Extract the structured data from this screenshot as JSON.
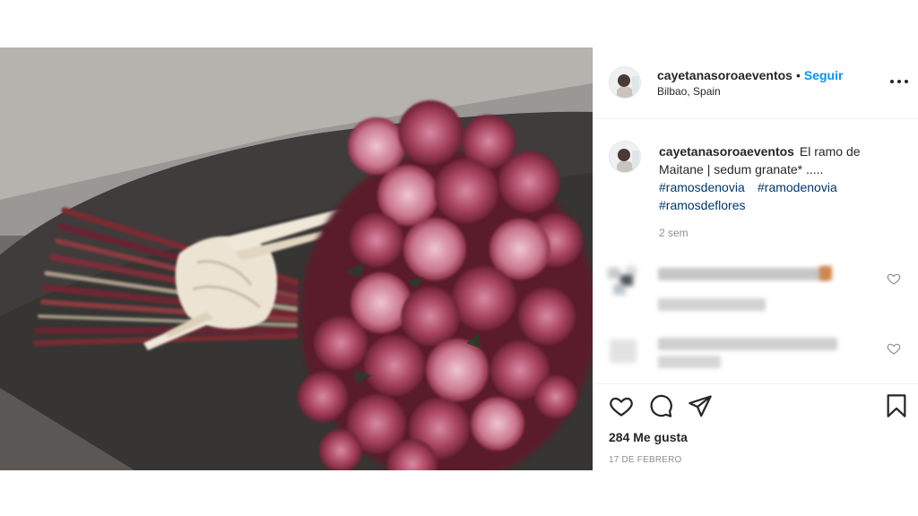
{
  "post": {
    "username": "cayetanasoroaeventos",
    "separator": "•",
    "follow_label": "Seguir",
    "location": "Bilbao, Spain",
    "caption_text": "El ramo de Maitane | sedum granate* .....",
    "hashtags": [
      "#ramosdenovia",
      "#ramodenovia",
      "#ramosdeflores"
    ],
    "caption_time": "2 sem",
    "likes": "284 Me gusta",
    "date": "17 DE FEBRERO"
  },
  "icons": {
    "more": "more-options-icon",
    "like": "heart-icon",
    "comment": "comment-icon",
    "share": "send-icon",
    "save": "bookmark-icon"
  },
  "colors": {
    "accent": "#0095f6",
    "hashtag": "#00376b",
    "text": "#262626",
    "muted": "#8e8e8e"
  }
}
